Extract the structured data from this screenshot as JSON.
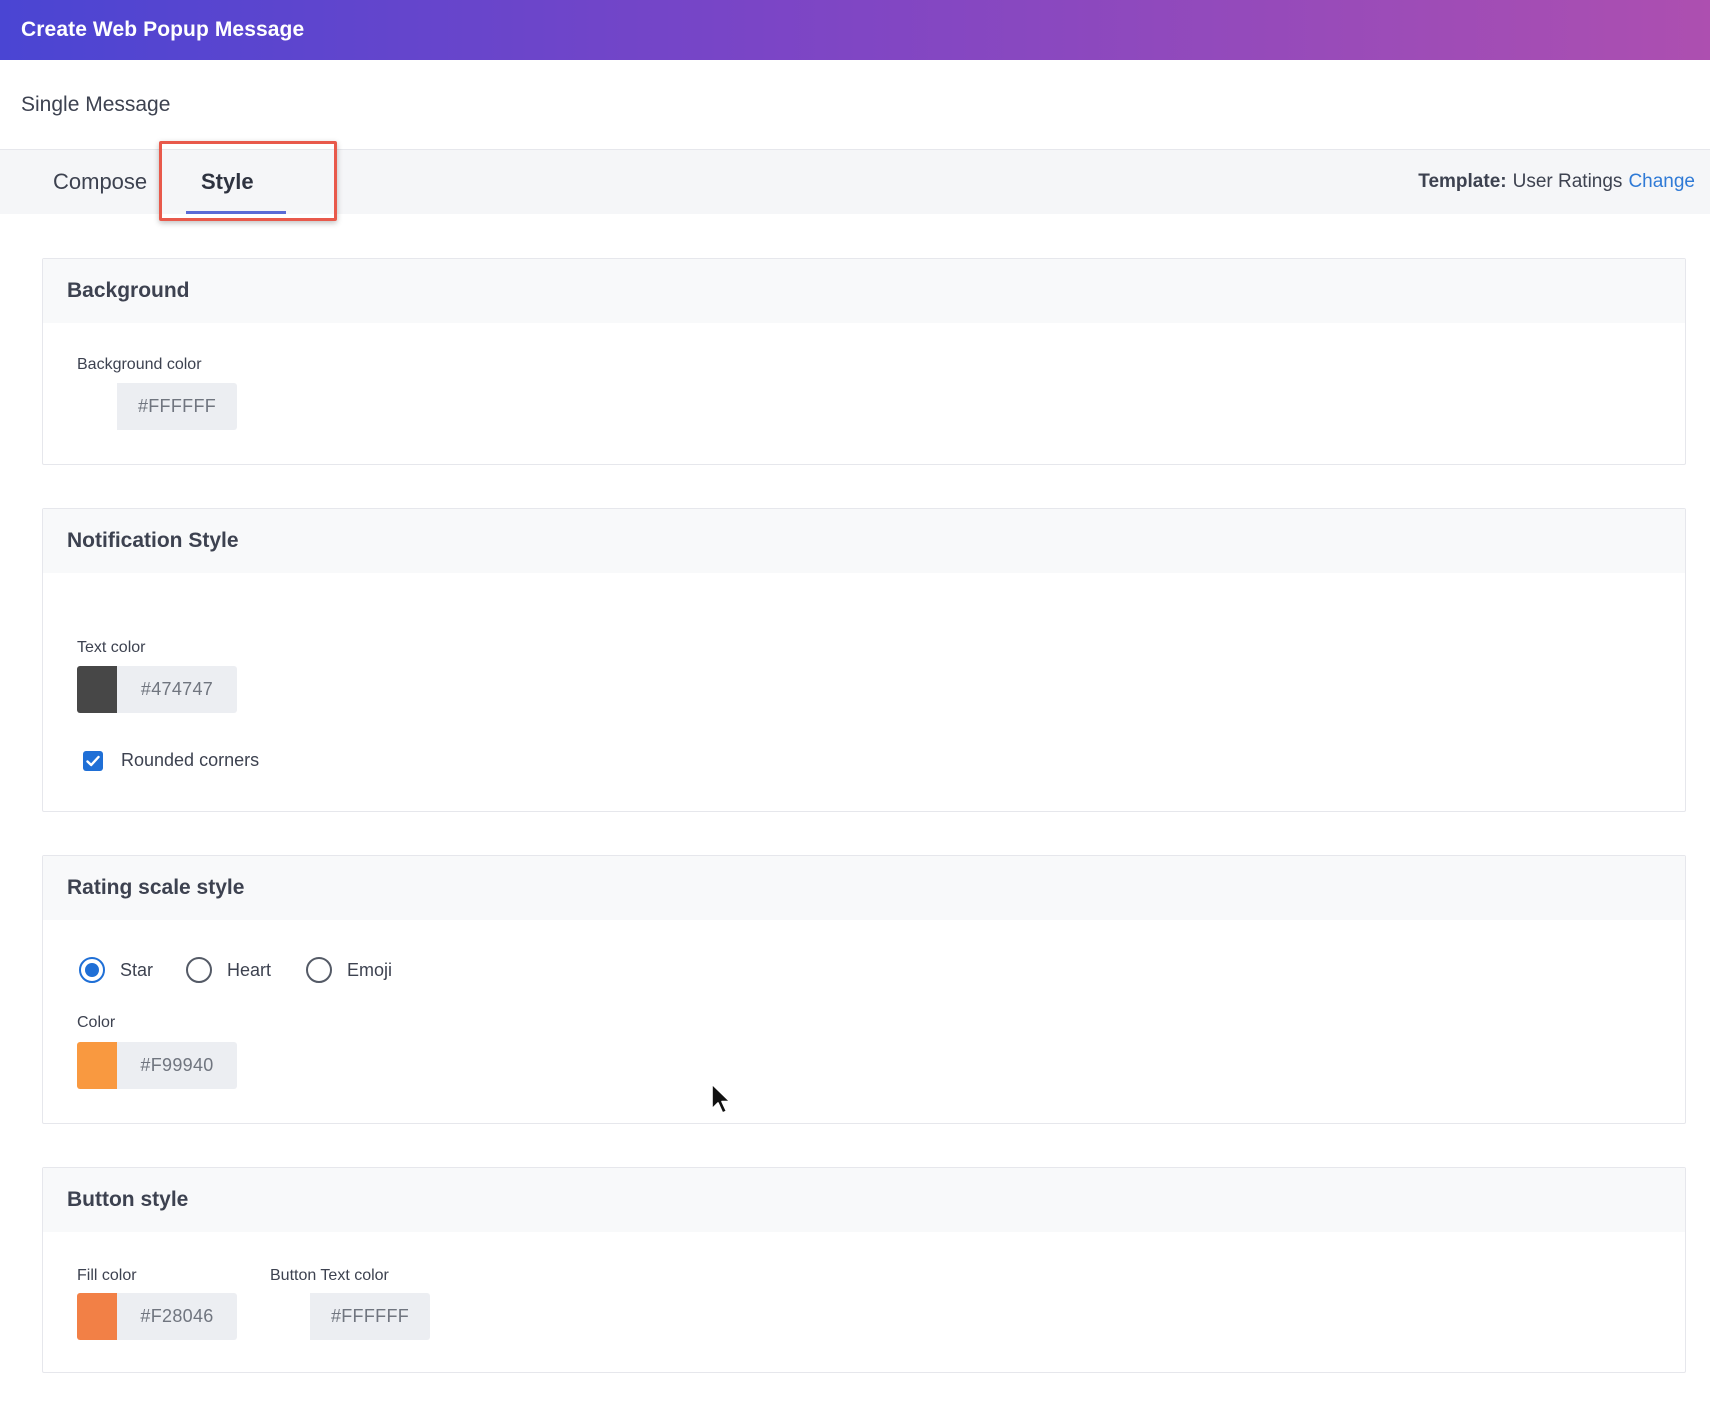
{
  "header": {
    "title": "Create Web Popup Message"
  },
  "subheader": {
    "title": "Single Message"
  },
  "tabs": {
    "compose": "Compose",
    "style": "Style",
    "active": "Style"
  },
  "template": {
    "label": "Template:",
    "name": "User Ratings",
    "change": "Change"
  },
  "background": {
    "title": "Background",
    "color_label": "Background color",
    "color_value": "#FFFFFF"
  },
  "notification": {
    "title": "Notification Style",
    "text_color_label": "Text color",
    "text_color_value": "#474747",
    "rounded_corners_label": "Rounded corners",
    "rounded_corners_checked": true
  },
  "rating": {
    "title": "Rating scale style",
    "options": [
      "Star",
      "Heart",
      "Emoji"
    ],
    "selected": "Star",
    "color_label": "Color",
    "color_value": "#F99940"
  },
  "button_style": {
    "title": "Button style",
    "fill_label": "Fill color",
    "fill_value": "#F28046",
    "text_label": "Button Text color",
    "text_value": "#FFFFFF"
  },
  "colors": {
    "header_start": "#4a45d3",
    "header_end": "#ad4fb0",
    "accent": "#1f6fd6",
    "link": "#2f7ad6",
    "highlight": "#e8594b"
  }
}
